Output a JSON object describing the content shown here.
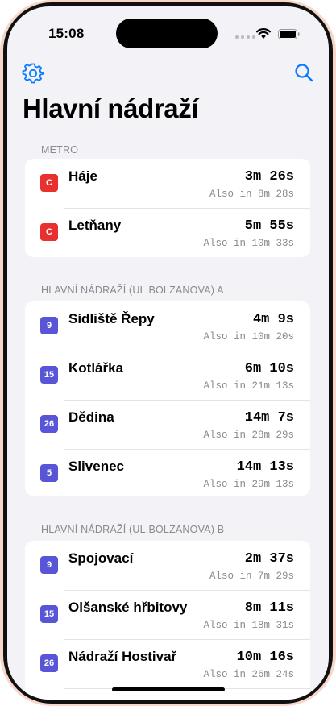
{
  "status_bar": {
    "time": "15:08"
  },
  "toolbar": {
    "settings_icon": "gear-icon",
    "search_icon": "magnifying-glass-icon"
  },
  "page": {
    "title": "Hlavní nádraží"
  },
  "colors": {
    "accent": "#0a7aff",
    "metro_c": "#e8312e",
    "tram": "#5856d6",
    "background": "#f2f2f7"
  },
  "sections": [
    {
      "header": "METRO",
      "rows": [
        {
          "badge": "C",
          "badge_type": "metro",
          "name": "Háje",
          "eta": "3m 26s",
          "also": "Also in 8m 28s"
        },
        {
          "badge": "C",
          "badge_type": "metro",
          "name": "Letňany",
          "eta": "5m 55s",
          "also": "Also in 10m 33s"
        }
      ]
    },
    {
      "header": "HLAVNÍ NÁDRAŽÍ (UL.BOLZANOVA) A",
      "rows": [
        {
          "badge": "9",
          "badge_type": "tram",
          "name": "Sídliště Řepy",
          "eta": "4m 9s",
          "also": "Also in 10m 20s"
        },
        {
          "badge": "15",
          "badge_type": "tram",
          "name": "Kotlářka",
          "eta": "6m 10s",
          "also": "Also in 21m 13s"
        },
        {
          "badge": "26",
          "badge_type": "tram",
          "name": "Dědina",
          "eta": "14m 7s",
          "also": "Also in 28m 29s"
        },
        {
          "badge": "5",
          "badge_type": "tram",
          "name": "Slivenec",
          "eta": "14m 13s",
          "also": "Also in 29m 13s"
        }
      ]
    },
    {
      "header": "HLAVNÍ NÁDRAŽÍ (UL.BOLZANOVA) B",
      "rows": [
        {
          "badge": "9",
          "badge_type": "tram",
          "name": "Spojovací",
          "eta": "2m 37s",
          "also": "Also in 7m 29s"
        },
        {
          "badge": "15",
          "badge_type": "tram",
          "name": "Olšanské hřbitovy",
          "eta": "8m 11s",
          "also": "Also in 18m 31s"
        },
        {
          "badge": "26",
          "badge_type": "tram",
          "name": "Nádraží Hostivař",
          "eta": "10m 16s",
          "also": "Also in 26m 24s"
        }
      ]
    }
  ]
}
